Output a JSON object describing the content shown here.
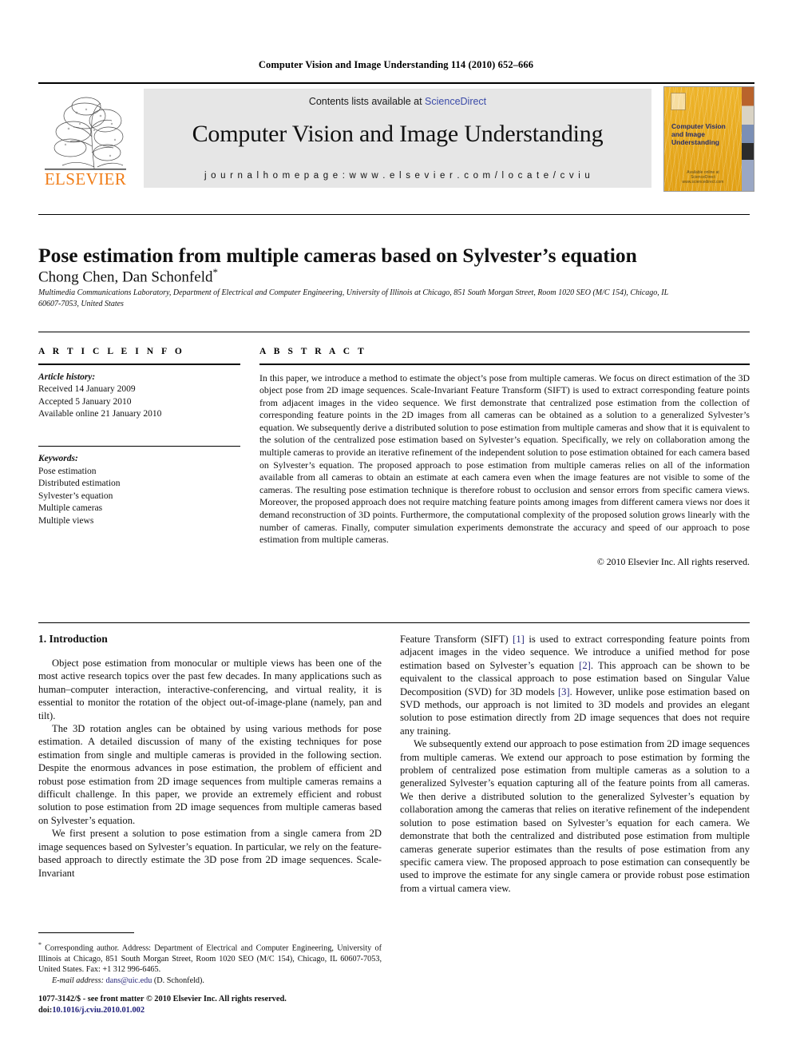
{
  "running_head": "Computer Vision and Image Understanding 114 (2010) 652–666",
  "masthead": {
    "contents_prefix": "Contents lists available at ",
    "sciencedirect": "ScienceDirect",
    "journal_title": "Computer Vision and Image Understanding",
    "homepage": "j o u r n a l   h o m e p a g e :   w w w . e l s e v i e r . c o m / l o c a t e / c v i u",
    "publisher_wordmark": "ELSEVIER",
    "cover": {
      "title_line1": "Computer Vision",
      "title_line2": "and Image",
      "title_line3": "Understanding",
      "footer_line1": "Available online at",
      "footer_line2": "ScienceDirect",
      "footer_line3": "www.sciencedirect.com"
    },
    "link_color": "#3b4ba8",
    "band_color": "#e6e6e6",
    "elsevier_orange": "#f07d18"
  },
  "article": {
    "title": "Pose estimation from multiple cameras based on Sylvester’s equation",
    "authors": "Chong Chen, Dan Schonfeld",
    "corresponding_marker": "*",
    "affiliation": "Multimedia Communications Laboratory, Department of Electrical and Computer Engineering, University of Illinois at Chicago, 851 South Morgan Street, Room 1020 SEO (M/C 154), Chicago, IL 60607-7053, United States"
  },
  "article_info": {
    "heading": "A R T I C L E  I N F O",
    "history_label": "Article history:",
    "history": [
      "Received 14 January 2009",
      "Accepted 5 January 2010",
      "Available online 21 January 2010"
    ],
    "keywords_label": "Keywords:",
    "keywords": [
      "Pose estimation",
      "Distributed estimation",
      "Sylvester’s equation",
      "Multiple cameras",
      "Multiple views"
    ]
  },
  "abstract": {
    "heading": "A B S T R A C T",
    "text": "In this paper, we introduce a method to estimate the object’s pose from multiple cameras. We focus on direct estimation of the 3D object pose from 2D image sequences. Scale-Invariant Feature Transform (SIFT) is used to extract corresponding feature points from adjacent images in the video sequence. We first demonstrate that centralized pose estimation from the collection of corresponding feature points in the 2D images from all cameras can be obtained as a solution to a generalized Sylvester’s equation. We subsequently derive a distributed solution to pose estimation from multiple cameras and show that it is equivalent to the solution of the centralized pose estimation based on Sylvester’s equation. Specifically, we rely on collaboration among the multiple cameras to provide an iterative refinement of the independent solution to pose estimation obtained for each camera based on Sylvester’s equation. The proposed approach to pose estimation from multiple cameras relies on all of the information available from all cameras to obtain an estimate at each camera even when the image features are not visible to some of the cameras. The resulting pose estimation technique is therefore robust to occlusion and sensor errors from specific camera views. Moreover, the proposed approach does not require matching feature points among images from different camera views nor does it demand reconstruction of 3D points. Furthermore, the computational complexity of the proposed solution grows linearly with the number of cameras. Finally, computer simulation experiments demonstrate the accuracy and speed of our approach to pose estimation from multiple cameras.",
    "copyright": "© 2010 Elsevier Inc. All rights reserved."
  },
  "body": {
    "section_title": "1. Introduction",
    "left_paragraphs": [
      "Object pose estimation from monocular or multiple views has been one of the most active research topics over the past few decades. In many applications such as human–computer interaction, interactive-conferencing, and virtual reality, it is essential to monitor the rotation of the object out-of-image-plane (namely, pan and tilt).",
      "The 3D rotation angles can be obtained by using various methods for pose estimation. A detailed discussion of many of the existing techniques for pose estimation from single and multiple cameras is provided in the following section. Despite the enormous advances in pose estimation, the problem of efficient and robust pose estimation from 2D image sequences from multiple cameras remains a difficult challenge. In this paper, we provide an extremely efficient and robust solution to pose estimation from 2D image sequences from multiple cameras based on Sylvester’s equation.",
      "We first present a solution to pose estimation from a single camera from 2D image sequences based on Sylvester’s equation. In particular, we rely on the feature-based approach to directly estimate the 3D pose from 2D image sequences. Scale-Invariant"
    ],
    "right_paragraph_1_parts": {
      "a": "Feature Transform (SIFT) ",
      "ref1": "[1]",
      "b": " is used to extract corresponding feature points from adjacent images in the video sequence. We introduce a unified method for pose estimation based on Sylvester’s equation ",
      "ref2": "[2]",
      "c": ". This approach can be shown to be equivalent to the classical approach to pose estimation based on Singular Value Decomposition (SVD) for 3D models ",
      "ref3": "[3]",
      "d": ". However, unlike pose estimation based on SVD methods, our approach is not limited to 3D models and provides an elegant solution to pose estimation directly from 2D image sequences that does not require any training."
    },
    "right_paragraph_2": "We subsequently extend our approach to pose estimation from 2D image sequences from multiple cameras. We extend our approach to pose estimation by forming the problem of centralized pose estimation from multiple cameras as a solution to a generalized Sylvester’s equation capturing all of the feature points from all cameras. We then derive a distributed solution to the generalized Sylvester’s equation by collaboration among the cameras that relies on iterative refinement of the independent solution to pose estimation based on Sylvester’s equation for each camera. We demonstrate that both the centralized and distributed pose estimation from multiple cameras generate superior estimates than the results of pose estimation from any specific camera view. The proposed approach to pose estimation can consequently be used to improve the estimate for any single camera or provide robust pose estimation from a virtual camera view."
  },
  "footnote": {
    "star": "*",
    "text": " Corresponding author. Address: Department of Electrical and Computer Engineering, University of Illinois at Chicago, 851 South Morgan Street, Room 1020 SEO (M/C 154), Chicago, IL 60607-7053, United States. Fax: +1 312 996-6465.",
    "email_label": "E-mail address:",
    "email": "dans@uic.edu",
    "email_suffix": " (D. Schonfeld)."
  },
  "imprint": {
    "issn_line": "1077-3142/$ - see front matter © 2010 Elsevier Inc. All rights reserved.",
    "doi_label": "doi:",
    "doi": "10.1016/j.cviu.2010.01.002"
  }
}
